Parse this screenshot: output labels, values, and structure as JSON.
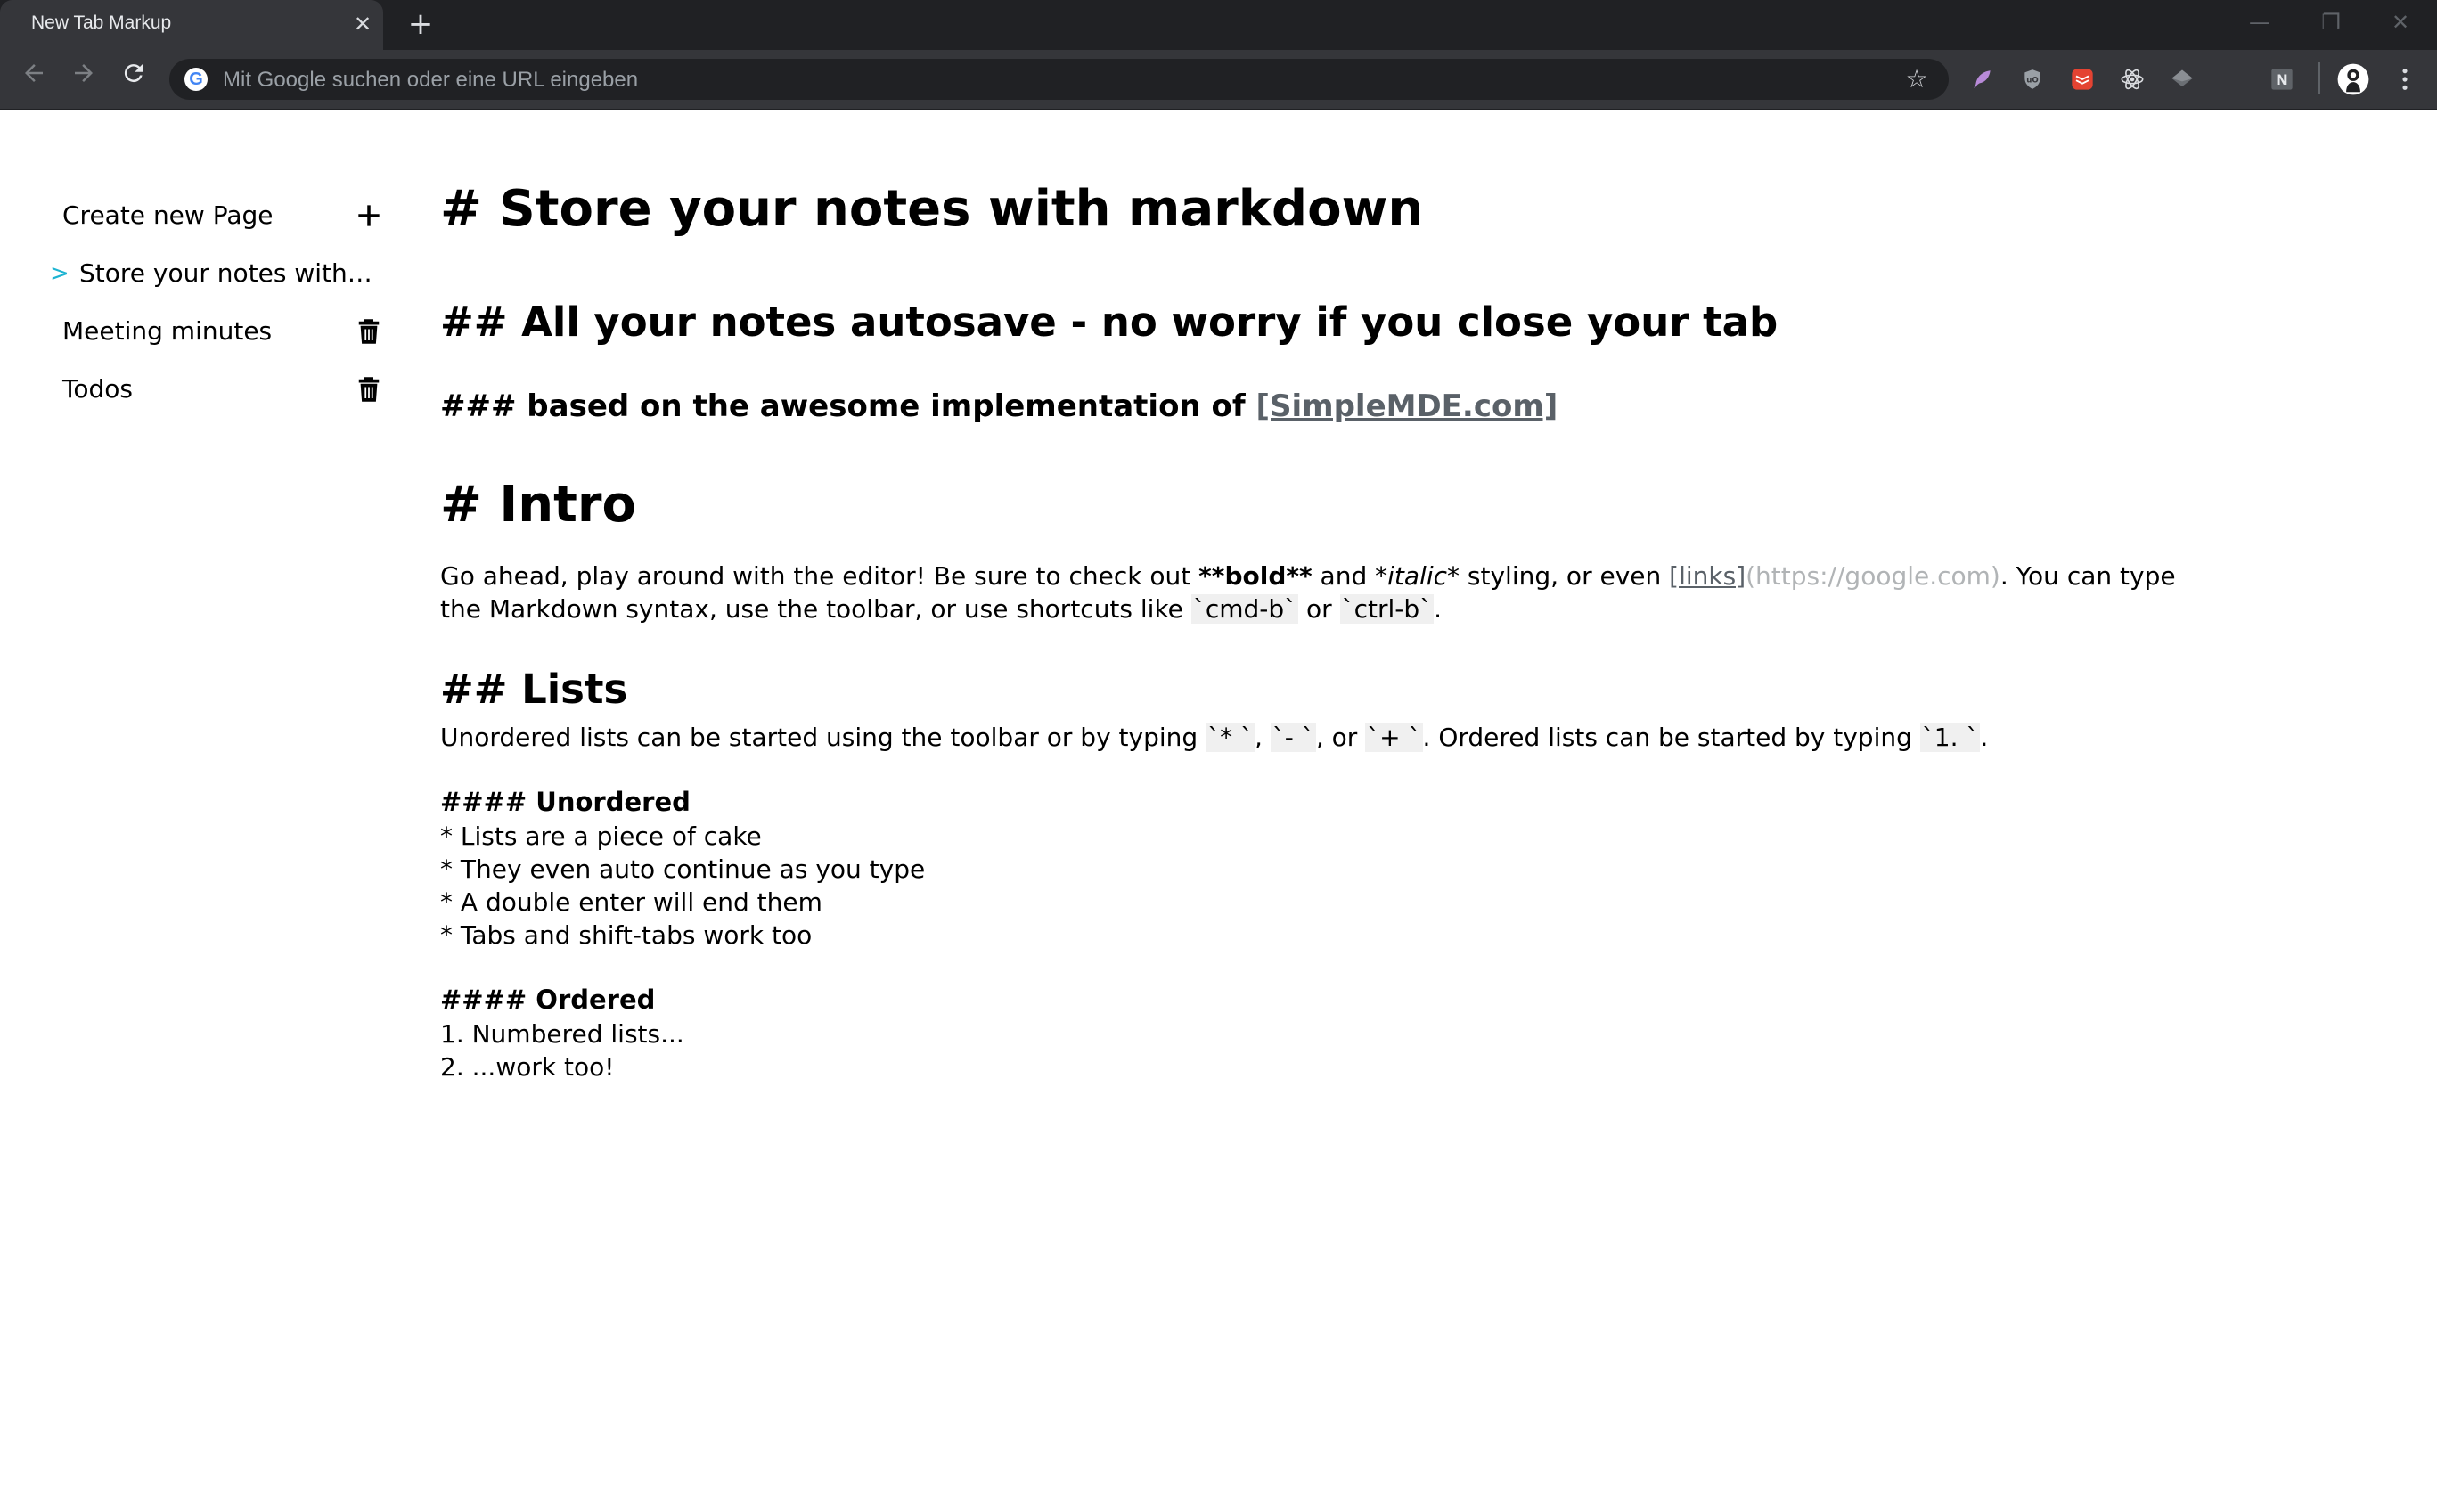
{
  "browser": {
    "tab_title": "New Tab Markup",
    "tab_close_glyph": "✕",
    "new_tab_glyph": "+",
    "omnibox_placeholder": "Mit Google suchen oder eine URL eingeben",
    "google_letter": "G",
    "bookmark_icon": "star-icon",
    "extension_icons": [
      "feather-icon",
      "ublock-shield-icon",
      "todoist-icon",
      "react-devtools-icon",
      "layers-icon",
      "notion-icon"
    ],
    "notion_letter": "N",
    "menu_icon": "three-dots-icon",
    "window_controls": [
      "—",
      "❐",
      "✕"
    ]
  },
  "sidebar": {
    "create_label": "Create new Page",
    "create_icon": "plus-icon",
    "active_arrow": ">",
    "items": [
      {
        "label": "Store your notes with markdown",
        "active": true
      },
      {
        "label": "Meeting minutes",
        "active": false,
        "action_icon": "trash-icon"
      },
      {
        "label": "Todos",
        "active": false,
        "action_icon": "trash-icon"
      }
    ]
  },
  "editor": {
    "h1_store": "# Store your notes with markdown",
    "h2_autosave": "## All your notes autosave - no worry if you close your tab",
    "h3_prefix": "### based on the awesome implementation of ",
    "h3_link": "[SimpleMDE.com]",
    "h1_intro": "# Intro",
    "intro": {
      "t1": "Go ahead, play around with the editor! Be sure to check out ",
      "bold": "**bold**",
      "t2": " and ",
      "italic": "*italic*",
      "t3": " styling, or even ",
      "link_text": "[links]",
      "link_url": "(https://google.com)",
      "t4": ". You can type the Markdown syntax, use the toolbar, or use shortcuts like ",
      "code1": "`cmd-b`",
      "t5": " or ",
      "code2": "`ctrl-b`",
      "t6": "."
    },
    "h2_lists": "## Lists",
    "lists_para": {
      "t1": "Unordered lists can be started using the toolbar or by typing ",
      "c1": "`* `",
      "t2": ", ",
      "c2": "`- `",
      "t3": ", or ",
      "c3": "`+ `",
      "t4": ". Ordered lists can be started by typing ",
      "c4": "`1. `",
      "t5": "."
    },
    "h4_unordered": "#### Unordered",
    "unordered": [
      "* Lists are a piece of cake",
      "* They even auto continue as you type",
      "* A double enter will end them",
      "* Tabs and shift-tabs work too"
    ],
    "h4_ordered": "#### Ordered",
    "ordered": [
      "1. Numbered lists...",
      "2. ...work too!"
    ]
  }
}
